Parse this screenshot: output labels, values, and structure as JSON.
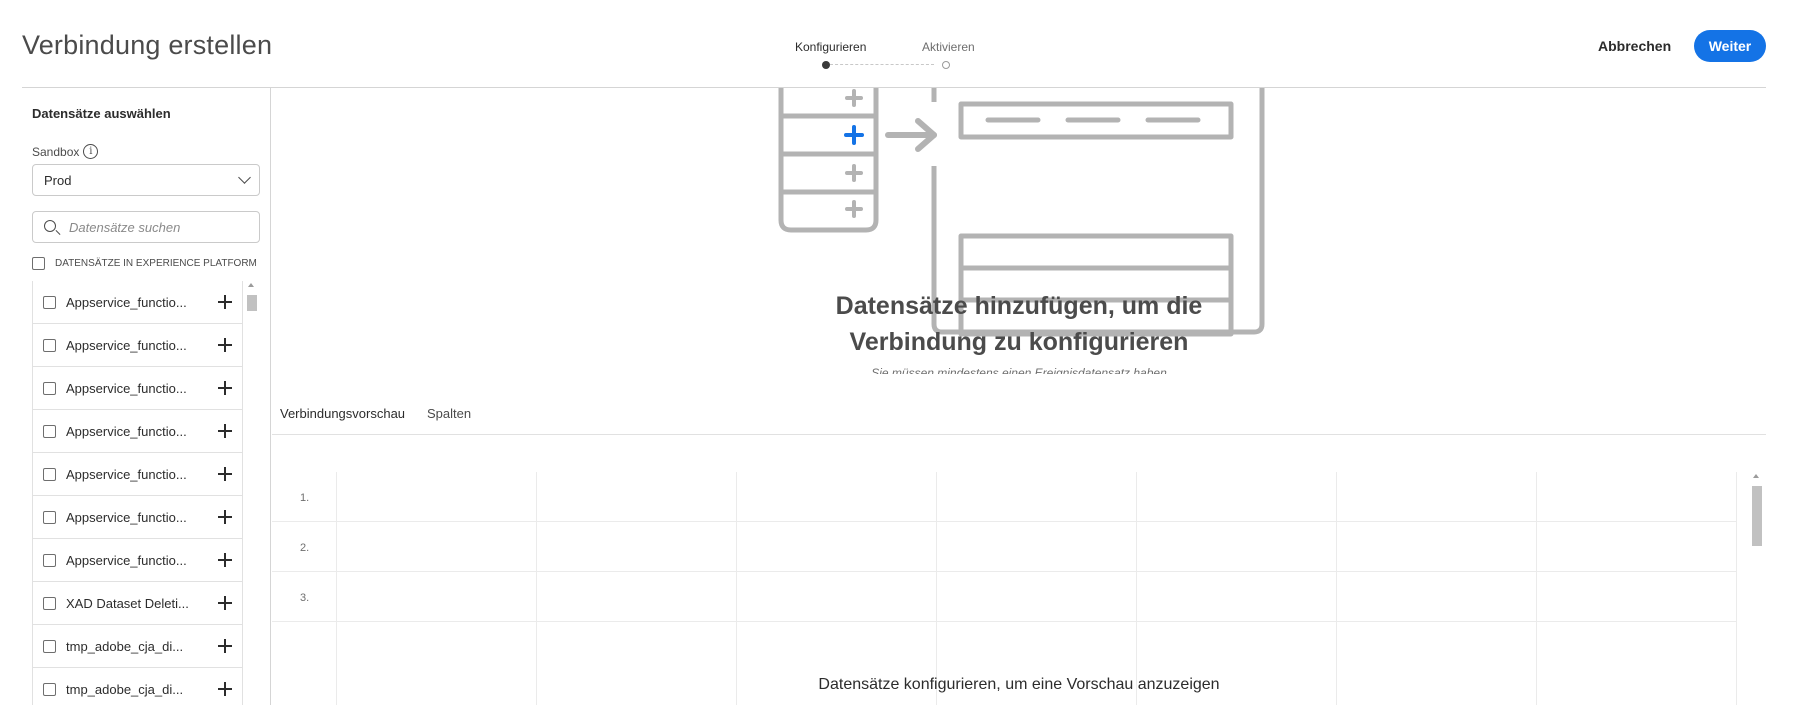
{
  "header": {
    "title": "Verbindung erstellen",
    "steps": [
      {
        "label": "Konfigurieren",
        "state": "active"
      },
      {
        "label": "Aktivieren",
        "state": "inactive"
      }
    ],
    "cancel_label": "Abbrechen",
    "next_label": "Weiter"
  },
  "sidebar": {
    "title": "Datensätze auswählen",
    "sandbox_label": "Sandbox",
    "sandbox_value": "Prod",
    "search_placeholder": "Datensätze suchen",
    "list_header": "DATENSÄTZE IN EXPERIENCE PLATFORM",
    "datasets": [
      "Appservice_functio...",
      "Appservice_functio...",
      "Appservice_functio...",
      "Appservice_functio...",
      "Appservice_functio...",
      "Appservice_functio...",
      "Appservice_functio...",
      "XAD Dataset Deleti...",
      "tmp_adobe_cja_di...",
      "tmp_adobe_cja_di..."
    ]
  },
  "main": {
    "empty_title_line1": "Datensätze hinzufügen, um die",
    "empty_title_line2": "Verbindung zu konfigurieren",
    "empty_subtitle": "Sie müssen mindestens einen Ereignisdatensatz haben",
    "tabs": [
      {
        "label": "Verbindungsvorschau",
        "selected": true
      },
      {
        "label": "Spalten",
        "selected": false
      }
    ],
    "row_numbers": [
      "1.",
      "2.",
      "3."
    ],
    "preview_message": "Datensätze konfigurieren, um eine Vorschau anzuzeigen"
  },
  "colors": {
    "accent": "#1473e6",
    "illustration_gray": "#b3b3b3",
    "illustration_plus_blue": "#1473e6"
  }
}
